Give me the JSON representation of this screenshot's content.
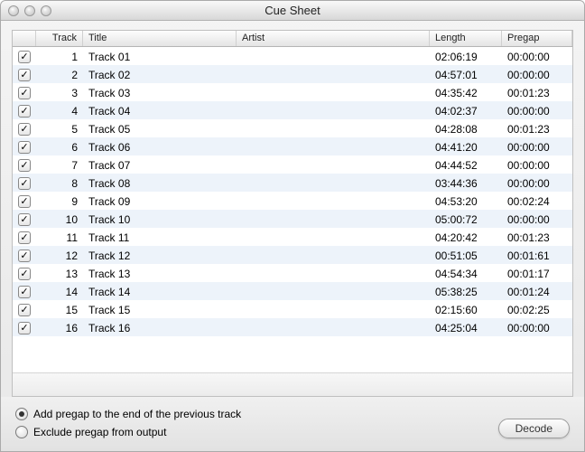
{
  "window": {
    "title": "Cue Sheet"
  },
  "columns": {
    "check": "",
    "track": "Track",
    "title": "Title",
    "artist": "Artist",
    "length": "Length",
    "pregap": "Pregap"
  },
  "tracks": [
    {
      "checked": true,
      "num": "1",
      "title": "Track 01",
      "artist": "",
      "length": "02:06:19",
      "pregap": "00:00:00"
    },
    {
      "checked": true,
      "num": "2",
      "title": "Track 02",
      "artist": "",
      "length": "04:57:01",
      "pregap": "00:00:00"
    },
    {
      "checked": true,
      "num": "3",
      "title": "Track 03",
      "artist": "",
      "length": "04:35:42",
      "pregap": "00:01:23"
    },
    {
      "checked": true,
      "num": "4",
      "title": "Track 04",
      "artist": "",
      "length": "04:02:37",
      "pregap": "00:00:00"
    },
    {
      "checked": true,
      "num": "5",
      "title": "Track 05",
      "artist": "",
      "length": "04:28:08",
      "pregap": "00:01:23"
    },
    {
      "checked": true,
      "num": "6",
      "title": "Track 06",
      "artist": "",
      "length": "04:41:20",
      "pregap": "00:00:00"
    },
    {
      "checked": true,
      "num": "7",
      "title": "Track 07",
      "artist": "",
      "length": "04:44:52",
      "pregap": "00:00:00"
    },
    {
      "checked": true,
      "num": "8",
      "title": "Track 08",
      "artist": "",
      "length": "03:44:36",
      "pregap": "00:00:00"
    },
    {
      "checked": true,
      "num": "9",
      "title": "Track 09",
      "artist": "",
      "length": "04:53:20",
      "pregap": "00:02:24"
    },
    {
      "checked": true,
      "num": "10",
      "title": "Track 10",
      "artist": "",
      "length": "05:00:72",
      "pregap": "00:00:00"
    },
    {
      "checked": true,
      "num": "11",
      "title": "Track 11",
      "artist": "",
      "length": "04:20:42",
      "pregap": "00:01:23"
    },
    {
      "checked": true,
      "num": "12",
      "title": "Track 12",
      "artist": "",
      "length": "00:51:05",
      "pregap": "00:01:61"
    },
    {
      "checked": true,
      "num": "13",
      "title": "Track 13",
      "artist": "",
      "length": "04:54:34",
      "pregap": "00:01:17"
    },
    {
      "checked": true,
      "num": "14",
      "title": "Track 14",
      "artist": "",
      "length": "05:38:25",
      "pregap": "00:01:24"
    },
    {
      "checked": true,
      "num": "15",
      "title": "Track 15",
      "artist": "",
      "length": "02:15:60",
      "pregap": "00:02:25"
    },
    {
      "checked": true,
      "num": "16",
      "title": "Track 16",
      "artist": "",
      "length": "04:25:04",
      "pregap": "00:00:00"
    }
  ],
  "options": {
    "add_pregap": "Add pregap to the end of the previous track",
    "exclude_pregap": "Exclude pregap from output",
    "selected": "add_pregap"
  },
  "buttons": {
    "decode": "Decode"
  },
  "glyphs": {
    "check": "✓"
  }
}
